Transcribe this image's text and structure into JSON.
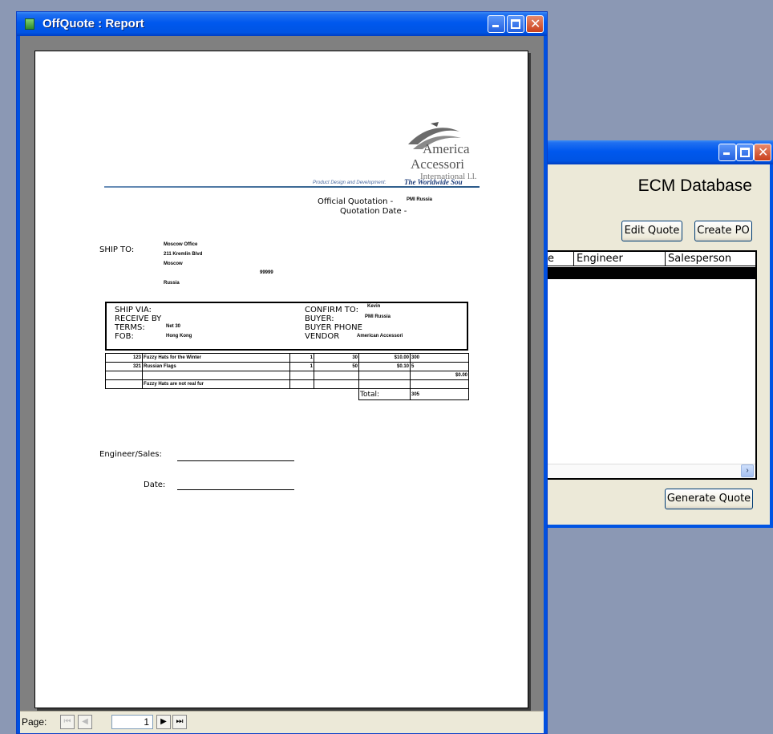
{
  "report_window": {
    "title": "OffQuote : Report",
    "status": {
      "page_label": "Page:",
      "page_number": "1"
    },
    "paper": {
      "logo": {
        "line1": "America",
        "line2": "Accessori",
        "line3": "International l.l.",
        "tagline_left": "Product Design and Development:",
        "tagline_right": "The Worldwide Sou"
      },
      "official_quotation_label": "Official Quotation -",
      "official_quotation_value": "PMI Russia",
      "quotation_date_label": "Quotation Date -",
      "ship_to": {
        "label": "SHIP TO:",
        "lines": [
          "Moscow Office",
          "211 Kremlin Blvd",
          "Moscow"
        ],
        "zip": "99999",
        "country": "Russia"
      },
      "ship_info": {
        "ship_via": "SHIP VIA:",
        "receive_by": "RECEIVE BY",
        "terms": "TERMS:",
        "terms_value": "Net 30",
        "fob": "FOB:",
        "fob_value": "Hong Kong",
        "confirm_to": "CONFIRM TO:",
        "confirm_to_value": "Kevin",
        "buyer": "BUYER:",
        "buyer_value": "PMI Russia",
        "buyer_phone": "BUYER PHONE",
        "vendor": "VENDOR",
        "vendor_value": "American Accessori"
      },
      "items": [
        {
          "num": "123",
          "desc": "Fuzzy Hats for the Winter",
          "qty": "1",
          "n2": "30",
          "price": "$10.00",
          "ext": "300"
        },
        {
          "num": "321",
          "desc": "Russian Flags",
          "qty": "1",
          "n2": "50",
          "price": "$0.10",
          "ext": "5"
        }
      ],
      "blank_amount": "$0.00",
      "note": "Fuzzy Hats are not real fur",
      "total_label": "Total:",
      "total_value": "305",
      "engineer_sales_label": "Engineer/Sales:",
      "date_label": "Date:"
    }
  },
  "ecm_window": {
    "title": "ECM Database",
    "buttons": {
      "edit_quote": "Edit Quote",
      "create_po": "Create PO",
      "generate_quote": "Generate Quote"
    },
    "columns": [
      "e",
      "Engineer",
      "Salesperson"
    ]
  },
  "colors": {
    "titlebar_blue": "#0054e3",
    "desktop": "#8b98b4",
    "grid_selection": "#000000"
  }
}
